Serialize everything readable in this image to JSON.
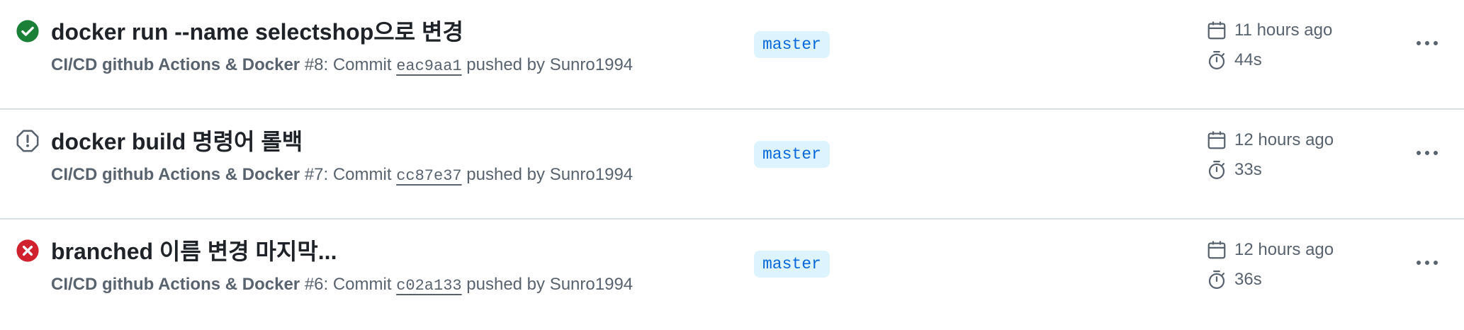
{
  "runs": [
    {
      "status": "success",
      "title": "docker run --name selectshop으로 변경",
      "workflow": "CI/CD github Actions & Docker",
      "run_number": "#8",
      "commit_prefix": ": Commit ",
      "sha": "eac9aa1",
      "pushed_by": " pushed by Sunro1994",
      "branch": "master",
      "when": "11 hours ago",
      "duration": "44s"
    },
    {
      "status": "cancelled",
      "title": "docker build 명령어 롤백",
      "workflow": "CI/CD github Actions & Docker",
      "run_number": "#7",
      "commit_prefix": ": Commit ",
      "sha": "cc87e37",
      "pushed_by": " pushed by Sunro1994",
      "branch": "master",
      "when": "12 hours ago",
      "duration": "33s"
    },
    {
      "status": "failure",
      "title": "branched 이름 변경 마지막...",
      "workflow": "CI/CD github Actions & Docker",
      "run_number": "#6",
      "commit_prefix": ": Commit ",
      "sha": "c02a133",
      "pushed_by": " pushed by Sunro1994",
      "branch": "master",
      "when": "12 hours ago",
      "duration": "36s"
    }
  ],
  "colors": {
    "success": "#1a7f37",
    "failure": "#cf222e",
    "neutral": "#59636e",
    "branch_bg": "#ddf4ff",
    "branch_fg": "#0969da"
  },
  "icons": {
    "success": "check-circle-icon",
    "cancelled": "stop-octagon-icon",
    "failure": "x-circle-icon",
    "when": "calendar-icon",
    "duration": "stopwatch-icon",
    "menu": "kebab-horizontal-icon"
  }
}
